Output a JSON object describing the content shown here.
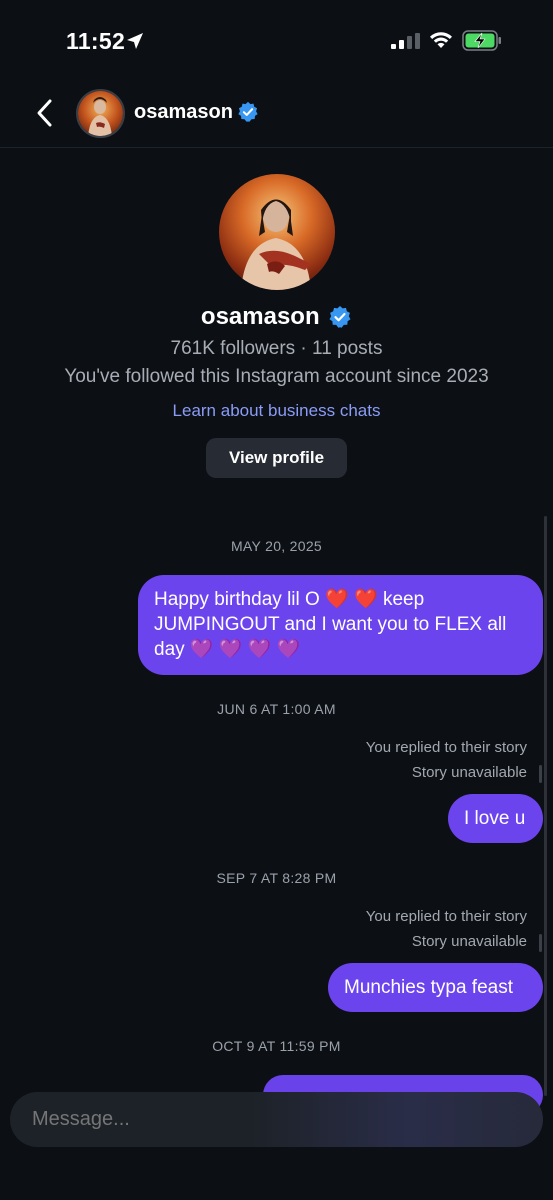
{
  "status_bar": {
    "time": "11:52",
    "location_icon": "location-arrow-icon",
    "signal_icon": "cellular-signal-icon",
    "wifi_icon": "wifi-icon",
    "battery_icon": "battery-charging-icon",
    "battery_color": "#4cd964"
  },
  "header": {
    "back_icon": "chevron-left-icon",
    "username": "osamason",
    "verified_icon": "verified-badge-icon",
    "verified_color": "#3897f0"
  },
  "profile": {
    "username": "osamason",
    "stats": "761K followers · 11 posts",
    "followed_since": "You've followed this Instagram account since 2023",
    "learn_link": "Learn about business chats",
    "view_profile_label": "View profile"
  },
  "chat": {
    "accent": "#6c44ee",
    "items": [
      {
        "type": "date",
        "text": "MAY 20, 2025"
      },
      {
        "type": "message",
        "line1": "Happy birthday lil O ❤️ ❤️  keep",
        "line2": "JUMPINGOUT and I want you to FLEX all",
        "line3": "day 💜 💜 💜 💜"
      },
      {
        "type": "date",
        "text": "JUN 6 AT 1:00 AM"
      },
      {
        "type": "story_reply",
        "line1": "You replied to their story",
        "line2": "Story unavailable"
      },
      {
        "type": "message",
        "text": "I love u"
      },
      {
        "type": "date",
        "text": "SEP 7 AT 8:28 PM"
      },
      {
        "type": "story_reply",
        "line1": "You replied to their story",
        "line2": "Story unavailable"
      },
      {
        "type": "message",
        "text": "Munchies typa feast"
      },
      {
        "type": "date",
        "text": "OCT 9 AT 11:59 PM"
      }
    ]
  },
  "composer": {
    "placeholder": "Message..."
  }
}
